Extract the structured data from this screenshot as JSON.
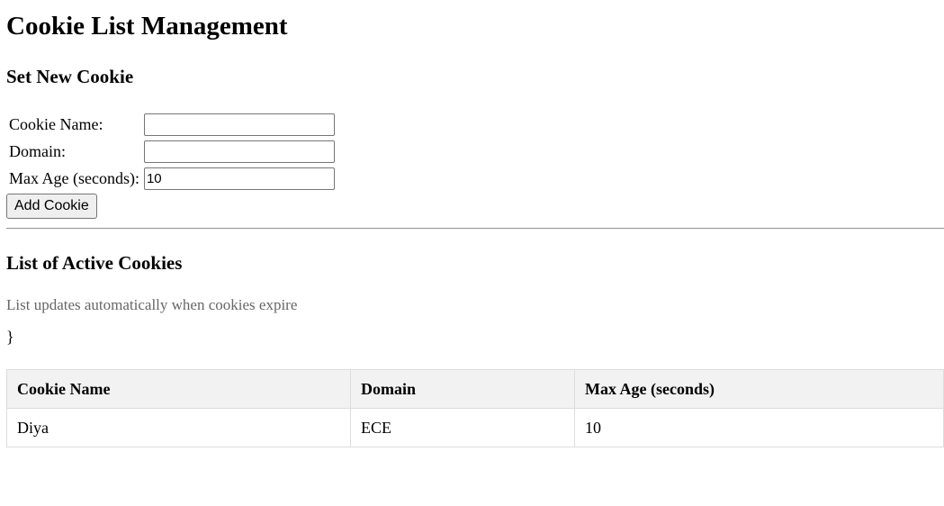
{
  "page": {
    "title": "Cookie List Management"
  },
  "form": {
    "heading": "Set New Cookie",
    "fields": {
      "name": {
        "label": "Cookie Name:",
        "value": ""
      },
      "domain": {
        "label": "Domain:",
        "value": ""
      },
      "max_age": {
        "label": "Max Age (seconds):",
        "value": "10"
      }
    },
    "submit_label": "Add Cookie"
  },
  "list": {
    "heading": "List of Active Cookies",
    "note": "List updates automatically when cookies expire",
    "stray_text": "}",
    "columns": [
      "Cookie Name",
      "Domain",
      "Max Age (seconds)"
    ],
    "rows": [
      {
        "name": "Diya",
        "domain": "ECE",
        "max_age": "10"
      }
    ]
  },
  "colors": {
    "header_bg": "#f2f2f2",
    "border": "#dddddd",
    "note_text": "#666666"
  }
}
